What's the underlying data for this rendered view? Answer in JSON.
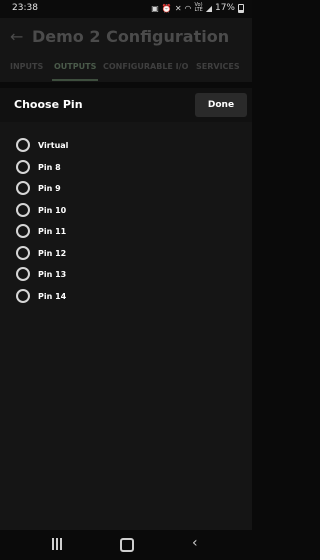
{
  "status_bar": {
    "time": "23:38",
    "icons": [
      "clipboard-icon",
      "alarm-icon",
      "mute-icon",
      "wifi-icon",
      "volte-icon",
      "signal-icon"
    ],
    "volte_text": "Vo)\nLTE",
    "battery": "17%"
  },
  "app_bar": {
    "title": "Demo 2 Configuration"
  },
  "tabs": [
    {
      "label": "INPUTS",
      "active": false
    },
    {
      "label": "OUTPUTS",
      "active": true
    },
    {
      "label": "CONFIGURABLE I/O",
      "active": false
    },
    {
      "label": "SERVICES",
      "active": false
    }
  ],
  "sheet": {
    "title": "Choose Pin",
    "done_label": "Done",
    "options": [
      {
        "label": "Virtual",
        "selected": false
      },
      {
        "label": "Pin 8",
        "selected": false
      },
      {
        "label": "Pin 9",
        "selected": false
      },
      {
        "label": "Pin 10",
        "selected": false
      },
      {
        "label": "Pin 11",
        "selected": false
      },
      {
        "label": "Pin 12",
        "selected": false
      },
      {
        "label": "Pin 13",
        "selected": false
      },
      {
        "label": "Pin 14",
        "selected": false
      }
    ]
  },
  "nav_bar": {
    "icons": [
      "recents-icon",
      "home-icon",
      "back-icon"
    ]
  },
  "colors": {
    "background": "#0a0a0a",
    "sheet": "#151515",
    "text": "#ffffff",
    "muted": "#4b4b4b",
    "tab_active": "#4a5a4a"
  }
}
